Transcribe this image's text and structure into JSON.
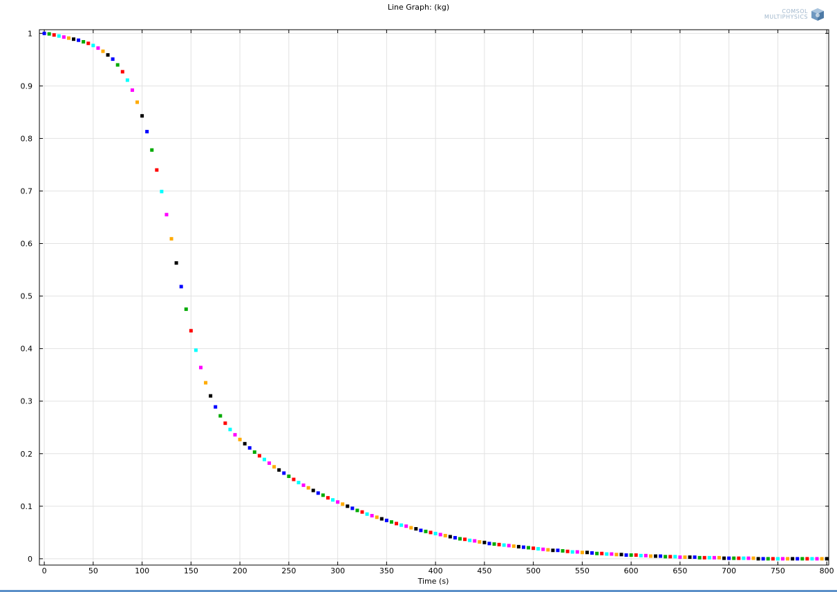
{
  "window": {
    "accent_color": "#5b8fc8"
  },
  "logo": {
    "line1": "COMSOL",
    "line2": "MULTIPHYSICS",
    "icon": "comsol-cube-icon"
  },
  "chart_data": {
    "type": "scatter",
    "title": "Line Graph:  (kg)",
    "xlabel": "Time (s)",
    "ylabel": "",
    "xlim": [
      -5,
      802
    ],
    "ylim": [
      -0.012,
      1.007
    ],
    "xticks": [
      "0",
      "50",
      "100",
      "150",
      "200",
      "250",
      "300",
      "350",
      "400",
      "450",
      "500",
      "550",
      "600",
      "650",
      "700",
      "750",
      "800"
    ],
    "yticks": [
      "0",
      "0.1",
      "0.2",
      "0.3",
      "0.4",
      "0.5",
      "0.6",
      "0.7",
      "0.8",
      "0.9",
      "1"
    ],
    "grid": true,
    "marker": "square",
    "color_cycle": [
      "#0000ff",
      "#00aa00",
      "#ff0000",
      "#00ffff",
      "#ff00ff",
      "#ffaa00",
      "#000000"
    ],
    "x": [
      0,
      5,
      10,
      15,
      20,
      25,
      30,
      35,
      40,
      45,
      50,
      55,
      60,
      65,
      70,
      75,
      80,
      85,
      90,
      95,
      100,
      105,
      110,
      115,
      120,
      125,
      130,
      135,
      140,
      145,
      150,
      155,
      160,
      165,
      170,
      175,
      180,
      185,
      190,
      195,
      200,
      205,
      210,
      215,
      220,
      225,
      230,
      235,
      240,
      245,
      250,
      255,
      260,
      265,
      270,
      275,
      280,
      285,
      290,
      295,
      300,
      305,
      310,
      315,
      320,
      325,
      330,
      335,
      340,
      345,
      350,
      355,
      360,
      365,
      370,
      375,
      380,
      385,
      390,
      395,
      400,
      405,
      410,
      415,
      420,
      425,
      430,
      435,
      440,
      445,
      450,
      455,
      460,
      465,
      470,
      475,
      480,
      485,
      490,
      495,
      500,
      505,
      510,
      515,
      520,
      525,
      530,
      535,
      540,
      545,
      550,
      555,
      560,
      565,
      570,
      575,
      580,
      585,
      590,
      595,
      600,
      605,
      610,
      615,
      620,
      625,
      630,
      635,
      640,
      645,
      650,
      655,
      660,
      665,
      670,
      675,
      680,
      685,
      690,
      695,
      700,
      705,
      710,
      715,
      720,
      725,
      730,
      735,
      740,
      745,
      750,
      755,
      760,
      765,
      770,
      775,
      780,
      785,
      790,
      795,
      800
    ],
    "y": [
      1.0,
      0.999,
      0.997,
      0.995,
      0.993,
      0.991,
      0.989,
      0.987,
      0.984,
      0.981,
      0.977,
      0.972,
      0.966,
      0.959,
      0.951,
      0.94,
      0.927,
      0.911,
      0.892,
      0.869,
      0.843,
      0.813,
      0.778,
      0.74,
      0.699,
      0.655,
      0.609,
      0.563,
      0.518,
      0.475,
      0.434,
      0.397,
      0.364,
      0.335,
      0.31,
      0.289,
      0.272,
      0.258,
      0.246,
      0.236,
      0.227,
      0.219,
      0.211,
      0.203,
      0.196,
      0.189,
      0.182,
      0.175,
      0.169,
      0.163,
      0.157,
      0.151,
      0.145,
      0.14,
      0.135,
      0.13,
      0.125,
      0.121,
      0.116,
      0.112,
      0.108,
      0.104,
      0.1,
      0.096,
      0.092,
      0.089,
      0.085,
      0.082,
      0.079,
      0.076,
      0.073,
      0.07,
      0.067,
      0.064,
      0.062,
      0.059,
      0.057,
      0.054,
      0.052,
      0.05,
      0.048,
      0.046,
      0.044,
      0.042,
      0.04,
      0.038,
      0.037,
      0.035,
      0.034,
      0.032,
      0.031,
      0.029,
      0.028,
      0.027,
      0.026,
      0.025,
      0.024,
      0.023,
      0.022,
      0.021,
      0.02,
      0.019,
      0.018,
      0.017,
      0.016,
      0.016,
      0.015,
      0.014,
      0.013,
      0.013,
      0.012,
      0.012,
      0.011,
      0.01,
      0.01,
      0.009,
      0.009,
      0.008,
      0.008,
      0.007,
      0.007,
      0.007,
      0.006,
      0.006,
      0.005,
      0.005,
      0.005,
      0.004,
      0.004,
      0.004,
      0.003,
      0.003,
      0.003,
      0.003,
      0.002,
      0.002,
      0.002,
      0.002,
      0.002,
      0.001,
      0.001,
      0.001,
      0.001,
      0.001,
      0.001,
      0.001,
      0.0,
      0.0,
      0.0,
      0.0,
      0.0,
      0.0,
      0.0,
      0.0,
      0.0,
      0.0,
      0.0,
      0.0,
      0.0,
      0.0,
      0.0,
      0.0,
      0.0,
      0.0,
      0.0
    ]
  }
}
